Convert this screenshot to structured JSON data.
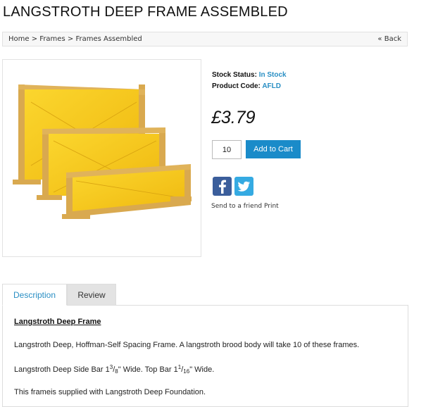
{
  "product": {
    "title": "LANGSTROTH DEEP FRAME ASSEMBLED",
    "stock_label": "Stock Status:",
    "stock_value": "In Stock",
    "code_label": "Product Code:",
    "code_value": "AFLD",
    "price": "£3.79",
    "quantity": "10",
    "add_to_cart": "Add to Cart"
  },
  "breadcrumb": {
    "items": [
      "Home",
      "Frames",
      "Frames Assembled"
    ],
    "separator": ">",
    "back": "« Back"
  },
  "share": {
    "send_to_friend": "Send to a friend",
    "print": "Print",
    "icons": [
      "facebook-icon",
      "twitter-icon"
    ]
  },
  "tabs": [
    "Description",
    "Review"
  ],
  "description": {
    "heading": "Langstroth Deep Frame",
    "p1": "Langstroth Deep, Hoffman-Self Spacing Frame. A langstroth brood body will take 10 of these frames.",
    "p2": {
      "pre": "Langstroth Deep Side Bar 1",
      "f1_num": "3",
      "f1_den": "8",
      "mid": "\" Wide. Top Bar 1",
      "f2_num": "1",
      "f2_den": "16",
      "post": "\" Wide."
    },
    "p3": "This frameis supplied with Langstroth Deep Foundation."
  },
  "colors": {
    "link_blue": "#2a8fc4",
    "button_blue": "#1a8bc9",
    "facebook": "#3b5e9b",
    "twitter": "#35aae2",
    "frame_yellow": "#f4c51c"
  }
}
